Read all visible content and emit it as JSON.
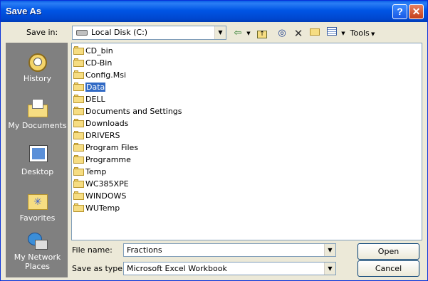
{
  "window": {
    "title": "Save As"
  },
  "titlebar": {
    "help": "?",
    "close": "✕"
  },
  "save_in": {
    "label": "Save in:",
    "value": "Local Disk (C:)"
  },
  "toolbar": {
    "tools_label": "Tools"
  },
  "places": [
    {
      "label_lines": [
        "History"
      ],
      "icon": "history-icon"
    },
    {
      "label_lines": [
        "My Documents"
      ],
      "icon": "my-documents-icon"
    },
    {
      "label_lines": [
        "Desktop"
      ],
      "icon": "desktop-icon"
    },
    {
      "label_lines": [
        "Favorites"
      ],
      "icon": "favorites-icon"
    },
    {
      "label_lines": [
        "My Network",
        "Places"
      ],
      "icon": "network-places-icon"
    }
  ],
  "files": [
    "CD_bin",
    "CD-Bin",
    "Config.Msi",
    "Data",
    "DELL",
    "Documents and Settings",
    "Downloads",
    "DRIVERS",
    "Program Files",
    "Programme",
    "Temp",
    "WC385XPE",
    "WINDOWS",
    "WUTemp"
  ],
  "selected_file": "Data",
  "file_name": {
    "label": "File name:",
    "value": "Fractions"
  },
  "save_type": {
    "label": "Save as type:",
    "value": "Microsoft Excel Workbook"
  },
  "buttons": {
    "open": "Open",
    "cancel": "Cancel"
  }
}
